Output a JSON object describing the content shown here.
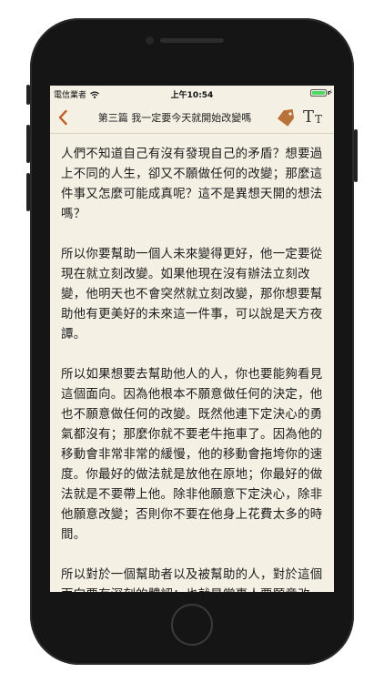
{
  "status_bar": {
    "carrier": "電信業者",
    "time": "上午10:54"
  },
  "nav": {
    "title": "第三篇 我一定要今天就開始改變嗎",
    "icons": [
      "chevron-left-icon",
      "tag-icon",
      "font-size-icon"
    ],
    "font_icon_large": "T",
    "font_icon_small": "T"
  },
  "colors": {
    "accent": "#c0622a",
    "page_background": "#f5f0e4",
    "tag": "#b8733a"
  },
  "article": {
    "paragraphs": [
      "人們不知道自己有沒有發現自己的矛盾？想要過上不同的人生，卻又不願做任何的改變；那麼這件事又怎麼可能成真呢？這不是異想天開的想法嗎？",
      "所以你要幫助一個人未來變得更好，他一定要從現在就立刻改變。如果他現在沒有辦法立刻改變，他明天也不會突然就立刻改變，那你想要幫助他有更美好的未來這一件事，可以說是天方夜譚。",
      "所以如果想要去幫助他人的人，你也要能夠看見這個面向。因為他根本不願意做任何的決定，他也不願意做任何的改變。既然他連下定決心的勇氣都沒有；那麼你就不要老牛拖車了。因為他的移動會非常非常的緩慢，他的移動會拖垮你的速度。你最好的做法就是放他在原地；你最好的做法就是不要帶上他。除非他願意下定決心，除非他願意改變；否則你不要在他身上花費太多的時間。",
      "所以對於一個幫助者以及被幫助的人，對於這個面向要有深刻的體認；也就是當事人要願意改變，而且幫助者也要看到當事人他願意改變；否則你無論如何再大的努力，最後也會功虧一簣。"
    ]
  }
}
